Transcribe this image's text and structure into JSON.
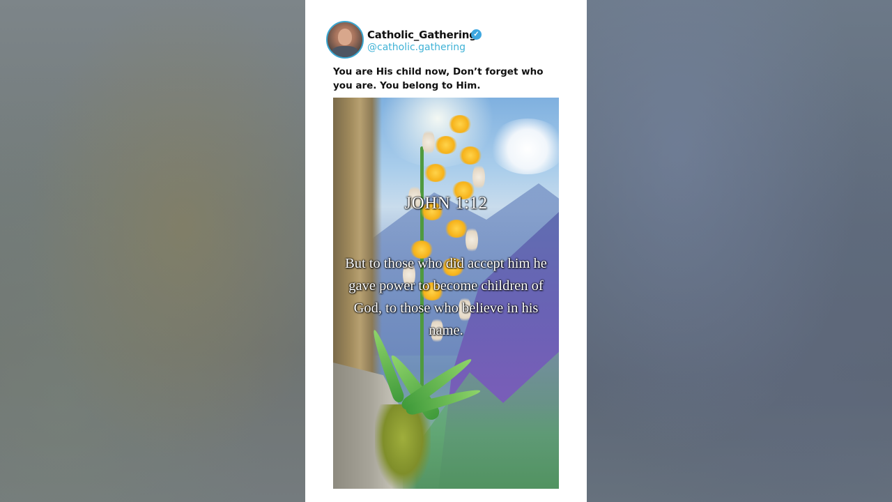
{
  "post": {
    "account_name": "Catholic_Gathering",
    "handle": "@catholic.gathering",
    "verified_icon": "verified-badge-icon",
    "caption": "You are His child now, Don’t forget who you are. You belong to Him.",
    "image": {
      "verse_reference": "JOHN 1:12",
      "verse_text": "But to those who did accept him he gave power to become children of God, to those who believe in his name."
    }
  },
  "colors": {
    "handle": "#3fb2d6",
    "verified": "#3ea7e0",
    "card_background": "#ffffff"
  }
}
